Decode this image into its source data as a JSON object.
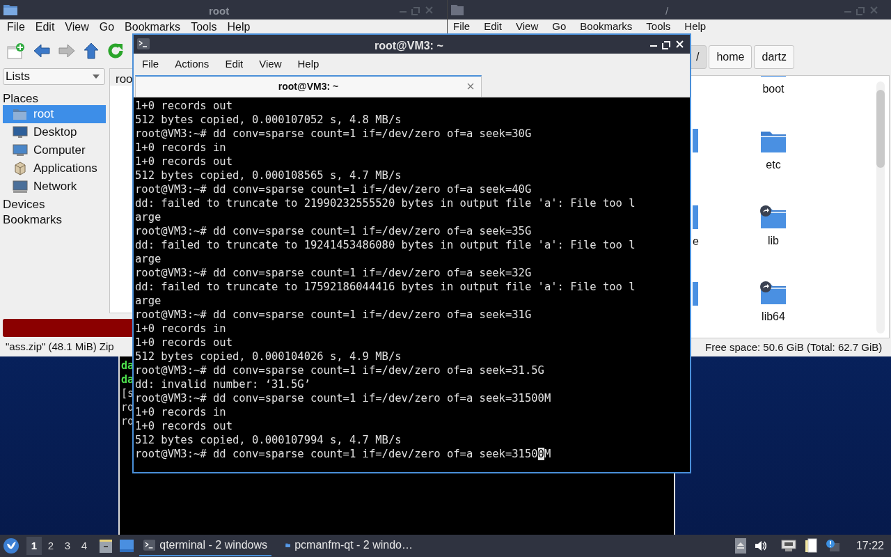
{
  "file_manager_left": {
    "title": "root",
    "menu": [
      "File",
      "Edit",
      "View",
      "Go",
      "Bookmarks",
      "Tools",
      "Help"
    ],
    "sidebar": {
      "dropdown": "Lists",
      "sections": [
        {
          "label": "Places",
          "items": [
            {
              "label": "root",
              "kind": "home",
              "selected": true
            },
            {
              "label": "Desktop",
              "kind": "desktop",
              "selected": false
            },
            {
              "label": "Computer",
              "kind": "computer",
              "selected": false
            },
            {
              "label": "Applications",
              "kind": "applications",
              "selected": false
            },
            {
              "label": "Network",
              "kind": "network",
              "selected": false
            }
          ]
        },
        {
          "label": "Devices"
        },
        {
          "label": "Bookmarks"
        }
      ]
    },
    "tab": "roo",
    "status": "\"ass.zip\" (48.1 MiB) Zip"
  },
  "file_manager_right": {
    "title": "/",
    "menu": [
      "File",
      "Edit",
      "View",
      "Go",
      "Bookmarks",
      "Tools",
      "Help"
    ],
    "path": [
      {
        "label": "/",
        "selected": true
      },
      {
        "label": "home",
        "selected": false
      },
      {
        "label": "dartz",
        "selected": false
      }
    ],
    "files": [
      {
        "name": "boot",
        "kind": "folder"
      },
      {
        "name": "etc",
        "kind": "folder"
      },
      {
        "name": "lib",
        "kind": "link"
      },
      {
        "name": "lib64",
        "kind": "link"
      }
    ],
    "partial_label": "e",
    "status": "Free space: 50.6 GiB (Total: 62.7 GiB)"
  },
  "background_terminal": {
    "lines": [
      {
        "text": "da",
        "kind": "green"
      },
      {
        "text": "da",
        "kind": "green"
      },
      {
        "text": "[s",
        "kind": "plain"
      },
      {
        "text": "ro",
        "kind": "plain"
      },
      {
        "text": "ro",
        "kind": "plain"
      }
    ]
  },
  "terminal": {
    "title": "root@VM3: ~",
    "menu": [
      "File",
      "Actions",
      "Edit",
      "View",
      "Help"
    ],
    "tab": "root@VM3: ~",
    "lines": [
      "1+0 records out",
      "512 bytes copied, 0.000107052 s, 4.8 MB/s",
      "root@VM3:~# dd conv=sparse count=1 if=/dev/zero of=a seek=30G",
      "1+0 records in",
      "1+0 records out",
      "512 bytes copied, 0.000108565 s, 4.7 MB/s",
      "root@VM3:~# dd conv=sparse count=1 if=/dev/zero of=a seek=40G",
      "dd: failed to truncate to 21990232555520 bytes in output file 'a': File too l",
      "arge",
      "root@VM3:~# dd conv=sparse count=1 if=/dev/zero of=a seek=35G",
      "dd: failed to truncate to 19241453486080 bytes in output file 'a': File too l",
      "arge",
      "root@VM3:~# dd conv=sparse count=1 if=/dev/zero of=a seek=32G",
      "dd: failed to truncate to 17592186044416 bytes in output file 'a': File too l",
      "arge",
      "root@VM3:~# dd conv=sparse count=1 if=/dev/zero of=a seek=31G",
      "1+0 records in",
      "1+0 records out",
      "512 bytes copied, 0.000104026 s, 4.9 MB/s",
      "root@VM3:~# dd conv=sparse count=1 if=/dev/zero of=a seek=31.5G",
      "dd: invalid number: ‘31.5G’",
      "root@VM3:~# dd conv=sparse count=1 if=/dev/zero of=a seek=31500M",
      "1+0 records in",
      "1+0 records out",
      "512 bytes copied, 0.000107994 s, 4.7 MB/s"
    ],
    "input_line": {
      "before": "root@VM3:~# dd conv=sparse count=1 if=/dev/zero of=a seek=3150",
      "cursor": "0",
      "after": "M"
    }
  },
  "taskbar": {
    "workspaces": [
      {
        "label": "1",
        "selected": true
      },
      {
        "label": "2",
        "selected": false
      },
      {
        "label": "3",
        "selected": false
      },
      {
        "label": "4",
        "selected": false
      }
    ],
    "tasks": [
      {
        "label": "qterminal - 2 windows",
        "kind": "terminal",
        "selected": true
      },
      {
        "label": "pcmanfm-qt - 2 windo…",
        "kind": "files",
        "selected": false
      }
    ],
    "clock": "17:22"
  }
}
